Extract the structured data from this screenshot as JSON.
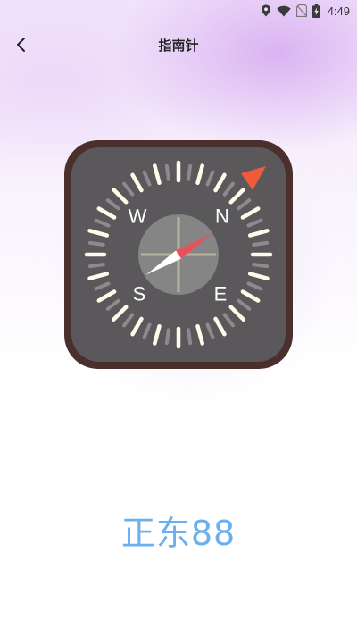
{
  "status_bar": {
    "time": "4:49",
    "icons": [
      "location-icon",
      "wifi-icon",
      "no-sim-icon",
      "battery-charging-icon"
    ]
  },
  "nav": {
    "back_icon": "chevron-left-icon",
    "title": "指南针"
  },
  "compass": {
    "labels": {
      "north": "N",
      "east": "E",
      "south": "S",
      "west": "W"
    },
    "heading_degrees": 88,
    "colors": {
      "frame": "#4a2f2c",
      "face": "#5a585b",
      "center": "#858585",
      "needle_north": "#e4535a",
      "needle_south": "#ffffff",
      "indicator": "#ee5a3a",
      "tick_major": "#fffbea",
      "tick_minor": "#8c8a8e"
    }
  },
  "direction_text": "正东88",
  "colors": {
    "direction_text": "#6ab0ef",
    "title_text": "#222222"
  }
}
